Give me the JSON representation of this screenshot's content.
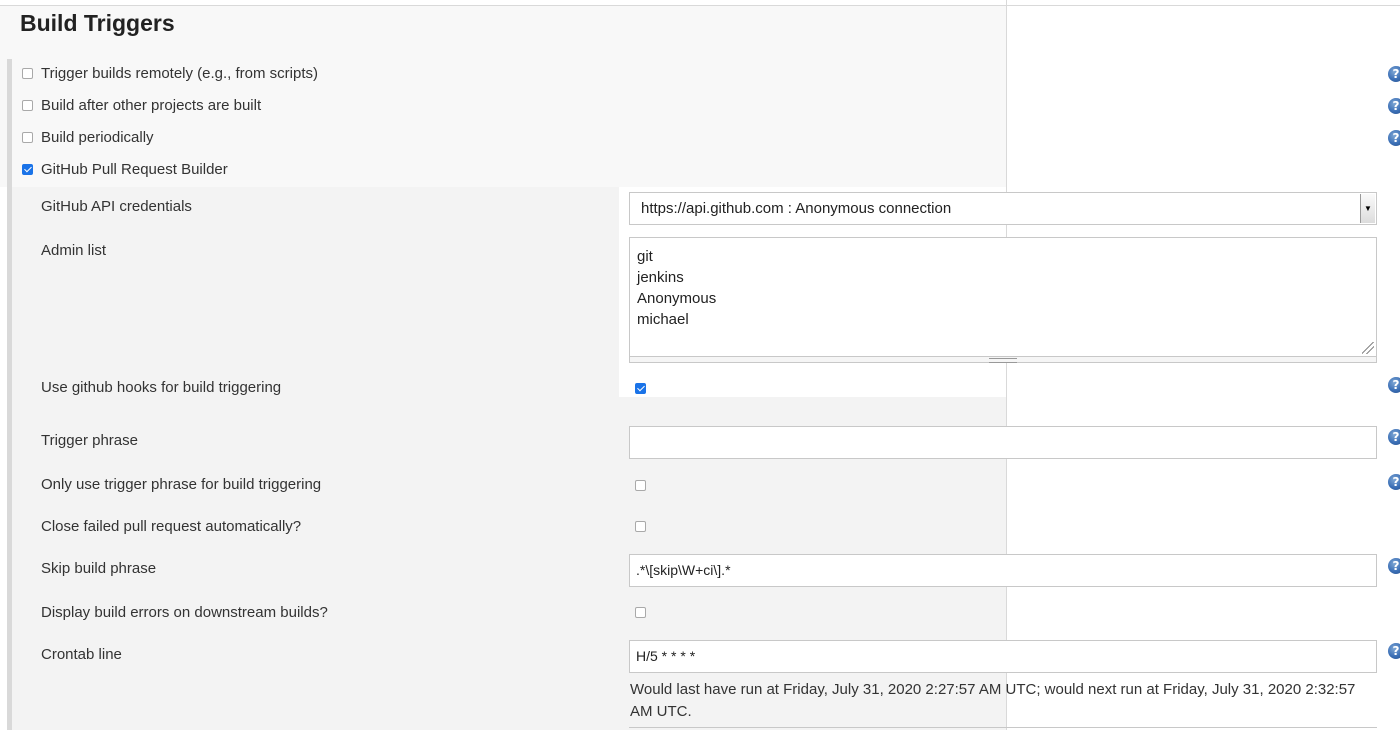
{
  "section": {
    "title": "Build Triggers"
  },
  "triggers": [
    {
      "label": "Trigger builds remotely (e.g., from scripts)",
      "checked": false
    },
    {
      "label": "Build after other projects are built",
      "checked": false
    },
    {
      "label": "Build periodically",
      "checked": false
    },
    {
      "label": "GitHub Pull Request Builder",
      "checked": true
    }
  ],
  "ghprb": {
    "credentials": {
      "label": "GitHub API credentials",
      "value": "https://api.github.com : Anonymous connection"
    },
    "admin_list": {
      "label": "Admin list",
      "lines": [
        "git",
        "jenkins",
        "Anonymous",
        "michael"
      ]
    },
    "use_hooks": {
      "label": "Use github hooks for build triggering",
      "checked": true
    },
    "trigger_phrase": {
      "label": "Trigger phrase",
      "value": ""
    },
    "only_trigger_phrase": {
      "label": "Only use trigger phrase for build triggering",
      "checked": false
    },
    "close_failed": {
      "label": "Close failed pull request automatically?",
      "checked": false
    },
    "skip_phrase": {
      "label": "Skip build phrase",
      "value": ".*\\[skip\\W+ci\\].*"
    },
    "display_errors": {
      "label": "Display build errors on downstream builds?",
      "checked": false
    },
    "crontab": {
      "label": "Crontab line",
      "value": "H/5 * * * *",
      "note": "Would last have run at Friday, July 31, 2020 2:27:57 AM UTC; would next run at Friday, July 31, 2020 2:32:57 AM UTC."
    }
  },
  "help_icon": {
    "name": "help-icon",
    "glyph": "?",
    "color": "#3b6fb6"
  },
  "colors": {
    "checkbox_checked": "#1a73e8",
    "panel_background": "#f3f3f3"
  }
}
